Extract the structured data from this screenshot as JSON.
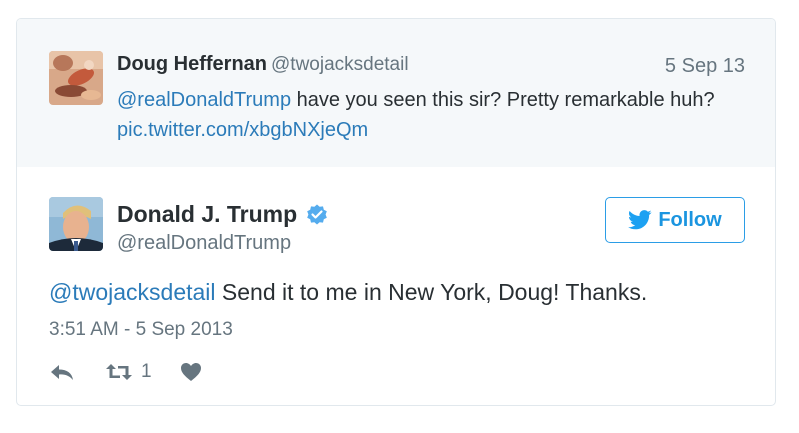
{
  "parent_tweet": {
    "author_name": "Doug Heffernan",
    "author_handle": "@twojacksdetail",
    "date": "5 Sep 13",
    "mention": "@realDonaldTrump",
    "text": " have you seen this sir? Pretty remarkable huh? ",
    "link": "pic.twitter.com/xbgbNXjeQm"
  },
  "tweet": {
    "author_name": "Donald J. Trump",
    "author_handle": "@realDonaldTrump",
    "verified_icon": "verified-badge-icon",
    "mention": "@twojacksdetail",
    "text": " Send it to me in New York, Doug! Thanks.",
    "timestamp": "3:51 AM - 5 Sep 2013",
    "retweet_count": "1"
  },
  "follow_button": {
    "label": "Follow",
    "icon": "twitter-bird-icon"
  },
  "actions": {
    "reply_icon": "reply-icon",
    "retweet_icon": "retweet-icon",
    "like_icon": "heart-icon"
  },
  "colors": {
    "link": "#2b7bb9",
    "accent": "#1da1f2",
    "muted": "#66757f",
    "parent_bg": "#f5f8fa"
  }
}
